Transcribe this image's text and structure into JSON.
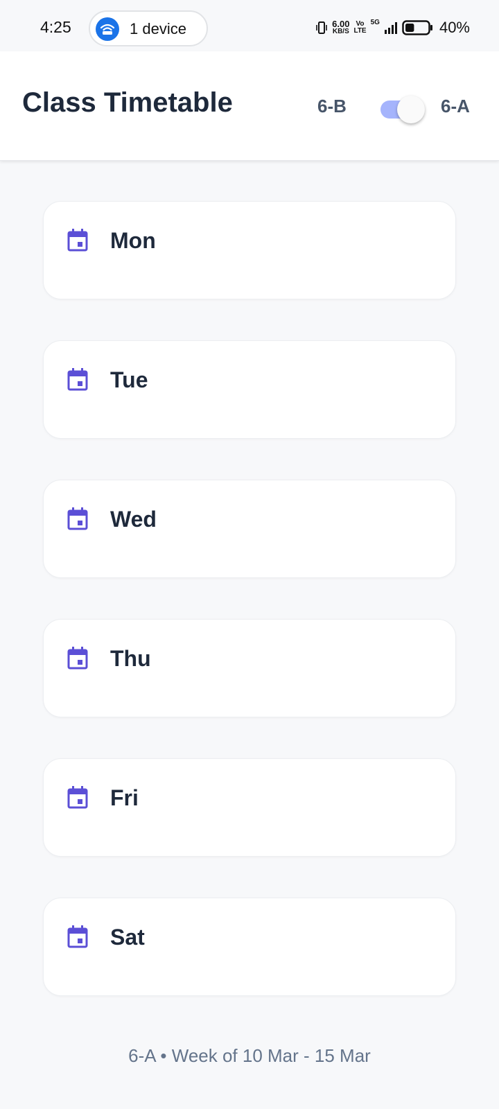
{
  "status_bar": {
    "time": "4:25",
    "hotspot_label": "1 device",
    "speed_value": "6.00",
    "speed_unit": "KB/S",
    "volte_top": "Vo",
    "volte_bottom": "LTE",
    "network": "5G",
    "battery": "40%",
    "battery_level": 0.4
  },
  "header": {
    "title": "Class Timetable",
    "class_left": "6-B",
    "class_right": "6-A",
    "toggle_on": true
  },
  "days": [
    {
      "label": "Mon"
    },
    {
      "label": "Tue"
    },
    {
      "label": "Wed"
    },
    {
      "label": "Thu"
    },
    {
      "label": "Fri"
    },
    {
      "label": "Sat"
    }
  ],
  "footer": {
    "text": "6-A • Week of 10 Mar - 15 Mar"
  },
  "colors": {
    "accent": "#5b4fd6",
    "toggle_track": "#a5b4fc",
    "hotspot": "#1a73e8",
    "background": "#f7f8fa"
  }
}
